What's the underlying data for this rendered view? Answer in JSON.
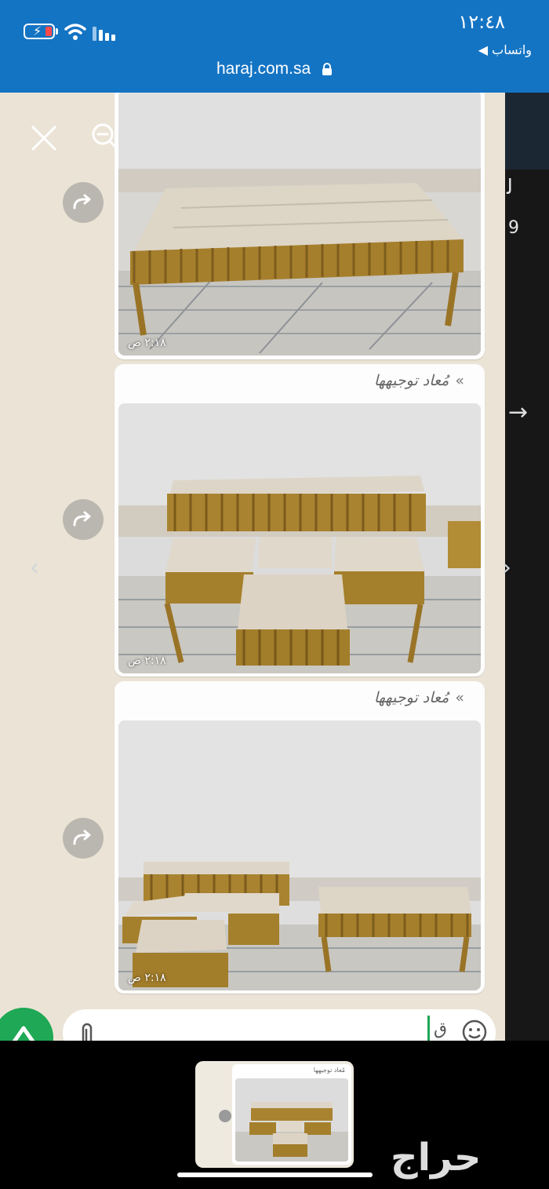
{
  "status_bar": {
    "time": "١٢:٤٨",
    "back_app": "◀ واتساب"
  },
  "browser": {
    "url": "haraj.com.sa"
  },
  "messages": [
    {
      "forwarded_label": "",
      "timestamp": "٢:١٨ ص"
    },
    {
      "forwarded_label": "مُعاد توجيهها",
      "timestamp": "٢:١٨ ص"
    },
    {
      "forwarded_label": "مُعاد توجيهها",
      "timestamp": "٢:١٨ ص"
    }
  ],
  "input": {
    "typed_text": "ق"
  },
  "thumbnail": {
    "label": "مُعاد توجيهها"
  },
  "watermark": "حراج",
  "icons": [
    "close-icon",
    "zoom-out-icon",
    "zoom-in-icon",
    "forward-icon",
    "attach-icon",
    "sticker-icon",
    "send-icon",
    "lock-icon",
    "wifi-icon",
    "signal-icon",
    "battery-icon"
  ],
  "colors": {
    "top_bar": "#1474c4",
    "send_button": "#1fa855",
    "chat_background": "#ebe4d6"
  }
}
